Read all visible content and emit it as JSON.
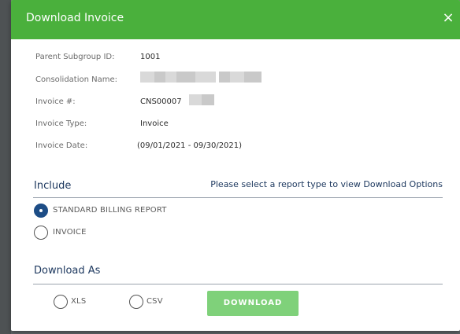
{
  "dialog": {
    "title": "Download Invoice",
    "close_glyph": "×"
  },
  "fields": {
    "parent_subgroup_id": {
      "label": "Parent Subgroup ID:",
      "value": "1001"
    },
    "consolidation_name": {
      "label": "Consolidation Name:",
      "value": ""
    },
    "invoice_number": {
      "label": "Invoice #:",
      "value": "CNS00007"
    },
    "invoice_type": {
      "label": "Invoice Type:",
      "value": "Invoice"
    },
    "invoice_date": {
      "label": "Invoice Date:",
      "value": "(09/01/2021 - 09/30/2021)"
    }
  },
  "include": {
    "title": "Include",
    "note": "Please select a report type to view Download Options",
    "options": [
      {
        "label": "STANDARD BILLING REPORT",
        "checked": true
      },
      {
        "label": "INVOICE",
        "checked": false
      }
    ]
  },
  "download_as": {
    "title": "Download As",
    "options": [
      {
        "label": "XLS",
        "checked": false
      },
      {
        "label": "CSV",
        "checked": false
      }
    ],
    "button_label": "DOWNLOAD"
  },
  "colors": {
    "header": "#4ab03c",
    "download_button": "#7fd17a",
    "section_title": "#1f3a60",
    "radio_checked": "#1d4d86"
  }
}
